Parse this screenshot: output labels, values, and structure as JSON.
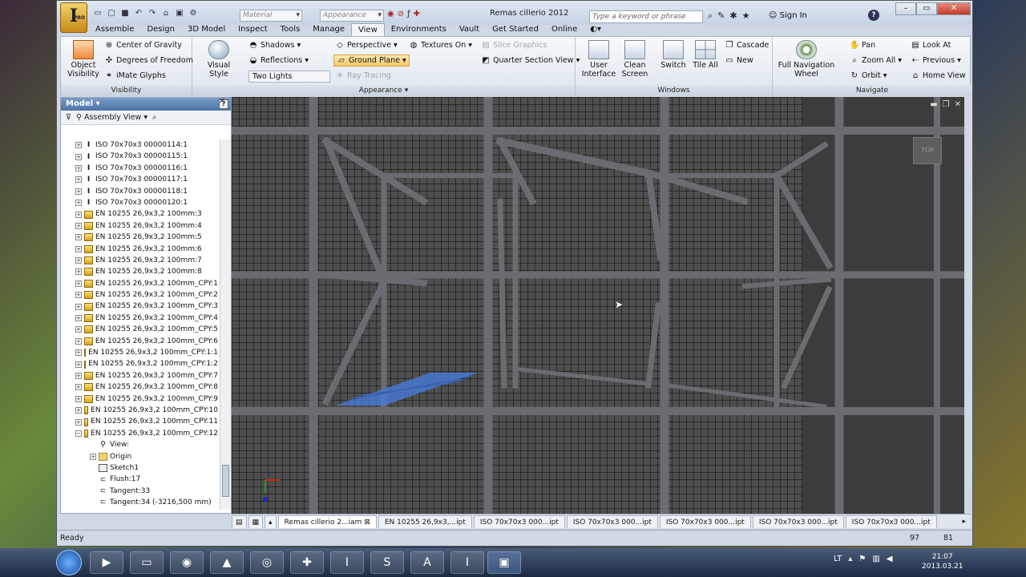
{
  "app": {
    "logo_letter": "I",
    "logo_sub": "PRO",
    "doc_title": "Remas cillerio 2012"
  },
  "qat": {
    "material_placeholder": "Material",
    "appearance_placeholder": "Appearance"
  },
  "help": {
    "search_placeholder": "Type a keyword or phrase",
    "sign_in": "Sign In"
  },
  "tabs": [
    "Assemble",
    "Design",
    "3D Model",
    "Inspect",
    "Tools",
    "Manage",
    "View",
    "Environments",
    "Vault",
    "Get Started",
    "Online"
  ],
  "ribbon": {
    "visibility": {
      "label": "Visibility",
      "object_visibility_1": "Object",
      "object_visibility_2": "Visibility",
      "center_of_gravity": "Center of Gravity",
      "degrees_of_freedom": "Degrees of Freedom",
      "imate_glyphs": "iMate Glyphs"
    },
    "appearance": {
      "label": "Appearance",
      "visual_style_1": "Visual Style",
      "shadows": "Shadows",
      "reflections": "Reflections",
      "lighting": "Two Lights",
      "perspective": "Perspective",
      "ground_plane": "Ground Plane",
      "ray_tracing": "Ray Tracing",
      "textures_on": "Textures On",
      "slice_graphics": "Slice Graphics",
      "quarter_section_view": "Quarter Section View"
    },
    "windows": {
      "label": "Windows",
      "user_interface_1": "User",
      "user_interface_2": "Interface",
      "clean_screen_1": "Clean",
      "clean_screen_2": "Screen",
      "switch": "Switch",
      "tile_all": "Tile All",
      "cascade": "Cascade",
      "new": "New"
    },
    "navigate": {
      "label": "Navigate",
      "full_nav_1": "Full Navigation",
      "full_nav_2": "Wheel",
      "pan": "Pan",
      "zoom_all": "Zoom All",
      "orbit": "Orbit",
      "look_at": "Look At",
      "previous": "Previous",
      "home_view": "Home View"
    }
  },
  "sidebar": {
    "title": "Model",
    "view_mode": "Assembly View",
    "items": [
      {
        "label": "ISO 70x70x3 00000114:1",
        "type": "beam"
      },
      {
        "label": "ISO 70x70x3 00000115:1",
        "type": "beam"
      },
      {
        "label": "ISO 70x70x3 00000116:1",
        "type": "beam"
      },
      {
        "label": "ISO 70x70x3 00000117:1",
        "type": "beam"
      },
      {
        "label": "ISO 70x70x3 00000118:1",
        "type": "beam"
      },
      {
        "label": "ISO 70x70x3 00000120:1",
        "type": "beam"
      },
      {
        "label": "EN 10255 26,9x3,2 100mm:3",
        "type": "part"
      },
      {
        "label": "EN 10255 26,9x3,2 100mm:4",
        "type": "part"
      },
      {
        "label": "EN 10255 26,9x3,2 100mm:5",
        "type": "part"
      },
      {
        "label": "EN 10255 26,9x3,2 100mm:6",
        "type": "part"
      },
      {
        "label": "EN 10255 26,9x3,2 100mm:7",
        "type": "part"
      },
      {
        "label": "EN 10255 26,9x3,2 100mm:8",
        "type": "part"
      },
      {
        "label": "EN 10255 26,9x3,2 100mm_CPY:1",
        "type": "part"
      },
      {
        "label": "EN 10255 26,9x3,2 100mm_CPY:2",
        "type": "part"
      },
      {
        "label": "EN 10255 26,9x3,2 100mm_CPY:3",
        "type": "part"
      },
      {
        "label": "EN 10255 26,9x3,2 100mm_CPY:4",
        "type": "part"
      },
      {
        "label": "EN 10255 26,9x3,2 100mm_CPY:5",
        "type": "part"
      },
      {
        "label": "EN 10255 26,9x3,2 100mm_CPY:6",
        "type": "part"
      },
      {
        "label": "EN 10255 26,9x3,2 100mm_CPY:1:1",
        "type": "part"
      },
      {
        "label": "EN 10255 26,9x3,2 100mm_CPY:1:2",
        "type": "part"
      },
      {
        "label": "EN 10255 26,9x3,2 100mm_CPY:7",
        "type": "part"
      },
      {
        "label": "EN 10255 26,9x3,2 100mm_CPY:8",
        "type": "part"
      },
      {
        "label": "EN 10255 26,9x3,2 100mm_CPY:9",
        "type": "part"
      },
      {
        "label": "EN 10255 26,9x3,2 100mm_CPY:10",
        "type": "part"
      },
      {
        "label": "EN 10255 26,9x3,2 100mm_CPY:11",
        "type": "part"
      },
      {
        "label": "EN 10255 26,9x3,2 100mm_CPY:12",
        "type": "part",
        "expanded": true
      }
    ],
    "children": [
      {
        "label": "View:",
        "type": "view",
        "expandable": false
      },
      {
        "label": "Origin",
        "type": "folder",
        "expandable": true
      },
      {
        "label": "Sketch1",
        "type": "sketch",
        "expandable": false
      },
      {
        "label": "Flush:17",
        "type": "constraint",
        "expandable": false
      },
      {
        "label": "Tangent:33",
        "type": "constraint",
        "expandable": false
      },
      {
        "label": "Tangent:34 (-3216,500 mm)",
        "type": "constraint",
        "expandable": false
      }
    ]
  },
  "viewcube": {
    "label": "TOP"
  },
  "doc_tabs": [
    "Remas cillerio 2...iam",
    "EN 10255 26,9x3,...ipt",
    "ISO 70x70x3 000...ipt",
    "ISO 70x70x3 000...ipt",
    "ISO 70x70x3 000...ipt",
    "ISO 70x70x3 000...ipt",
    "ISO 70x70x3 000...ipt"
  ],
  "status": {
    "text": "Ready",
    "count1": "97",
    "count2": "81"
  },
  "taskbar": {
    "lang": "LT",
    "time": "21:07",
    "date": "2013.03.21"
  },
  "colors": {
    "ribbon_highlight": "#f5c86a",
    "plate": "#4a78d0",
    "frame": "#6b6b72"
  }
}
